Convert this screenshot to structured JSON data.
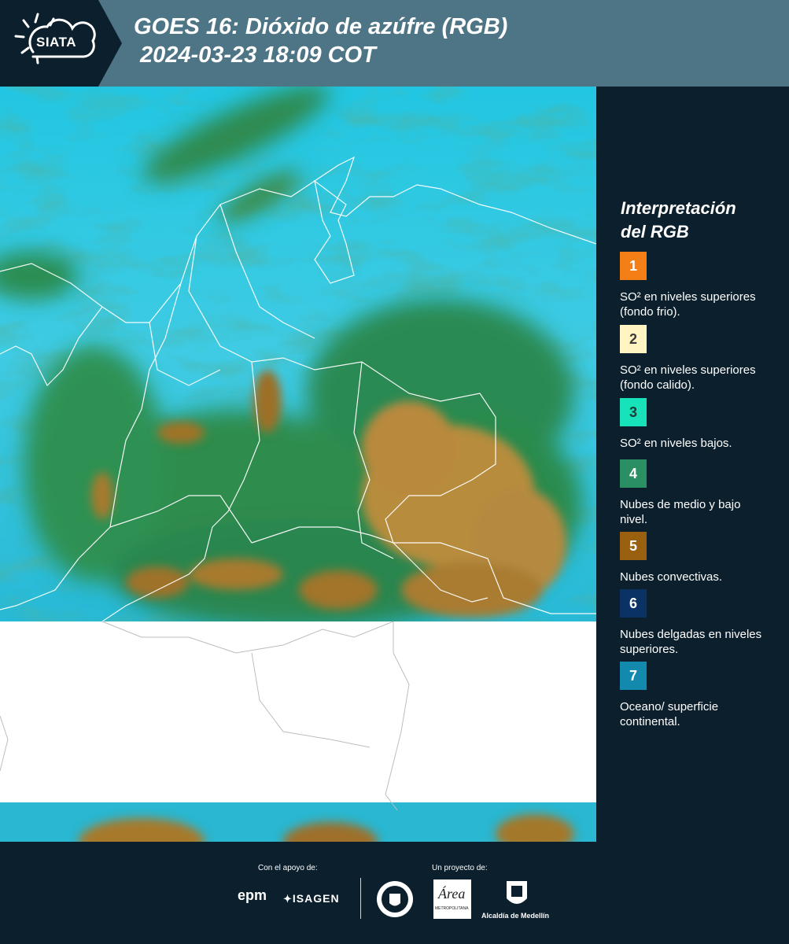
{
  "header": {
    "logo_text": "SIATA",
    "title_line1": "GOES 16: Dióxido de azúfre (RGB)",
    "title_line2": "2024-03-23 18:09 COT"
  },
  "legend": {
    "title_line1": "Interpretación",
    "title_line2": "del RGB",
    "items": [
      {
        "num": "1",
        "color": "#f47f17",
        "num_color": "#ffffff",
        "label": "SO² en niveles superiores (fondo frio)."
      },
      {
        "num": "2",
        "color": "#fff4c2",
        "num_color": "#3a3a3a",
        "label": "SO² en niveles superiores (fondo calido)."
      },
      {
        "num": "3",
        "color": "#17e2b9",
        "num_color": "#1a3a3a",
        "label": "SO² en niveles bajos."
      },
      {
        "num": "4",
        "color": "#2a8f63",
        "num_color": "#ffffff",
        "label": "Nubes de medio y bajo nivel."
      },
      {
        "num": "5",
        "color": "#98600f",
        "num_color": "#ffffff",
        "label": "Nubes convectivas."
      },
      {
        "num": "6",
        "color": "#0b3264",
        "num_color": "#ffffff",
        "label": "Nubes delgadas en niveles superiores."
      },
      {
        "num": "7",
        "color": "#1289ad",
        "num_color": "#ffffff",
        "label": "Oceano/ superficie continental."
      }
    ]
  },
  "footer": {
    "support_text": "Con el apoyo de:",
    "project_text": "Un proyecto de:",
    "logo_epm": "epm",
    "logo_isagen": "ISAGEN",
    "logo_area": "Área",
    "logo_area_sub": "METROPOLITANA",
    "logo_alcaldia": "Alcaldía de Medellín"
  }
}
